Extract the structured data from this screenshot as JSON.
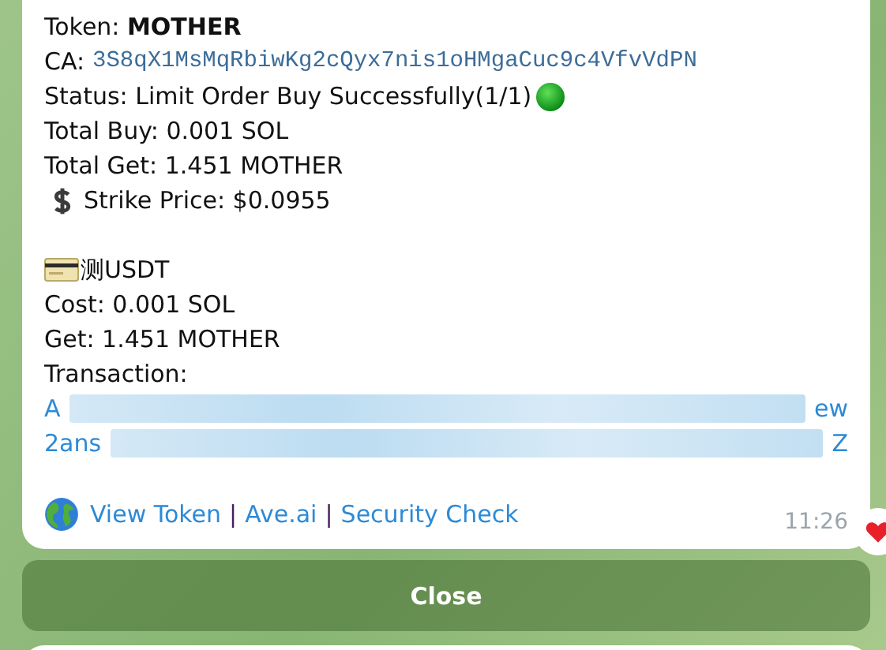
{
  "message": {
    "lines": [
      {
        "kind": "text",
        "text": "Token: **MOTHER**"
      },
      {
        "kind": "address",
        "label": "CA: ",
        "value": "3S8qX1MsMqRbiwKg2cQyx7nis1oHMgaCuc9c4VfvVdPN"
      },
      {
        "kind": "status",
        "text": "Status: Limit Order Buy Successfully(1/1)"
      },
      {
        "kind": "text",
        "text": "Total Buy: 0.001 SOL"
      },
      {
        "kind": "text",
        "text": "Total Get: 1.451 MOTHER"
      },
      {
        "kind": "price",
        "text": "Strike Price: $0.0955"
      },
      {
        "kind": "spacer"
      },
      {
        "kind": "wallet",
        "text": "测USDT"
      },
      {
        "kind": "text",
        "text": "Cost: 0.001 SOL"
      },
      {
        "kind": "text",
        "text": "Get: 1.451 MOTHER"
      },
      {
        "kind": "text",
        "text": "Transaction:"
      }
    ],
    "transaction_link": [
      {
        "start": "A",
        "end": "ew"
      },
      {
        "start": "2ans",
        "end": "Z"
      }
    ],
    "footer": [
      {
        "kind": "link",
        "text": "View Token"
      },
      {
        "kind": "separator",
        "text": "|"
      },
      {
        "kind": "link",
        "text": "Ave.ai"
      },
      {
        "kind": "separator",
        "text": "|"
      },
      {
        "kind": "link",
        "text": "Security Check"
      }
    ],
    "time": "11:26"
  },
  "buttons": [
    "Close"
  ]
}
